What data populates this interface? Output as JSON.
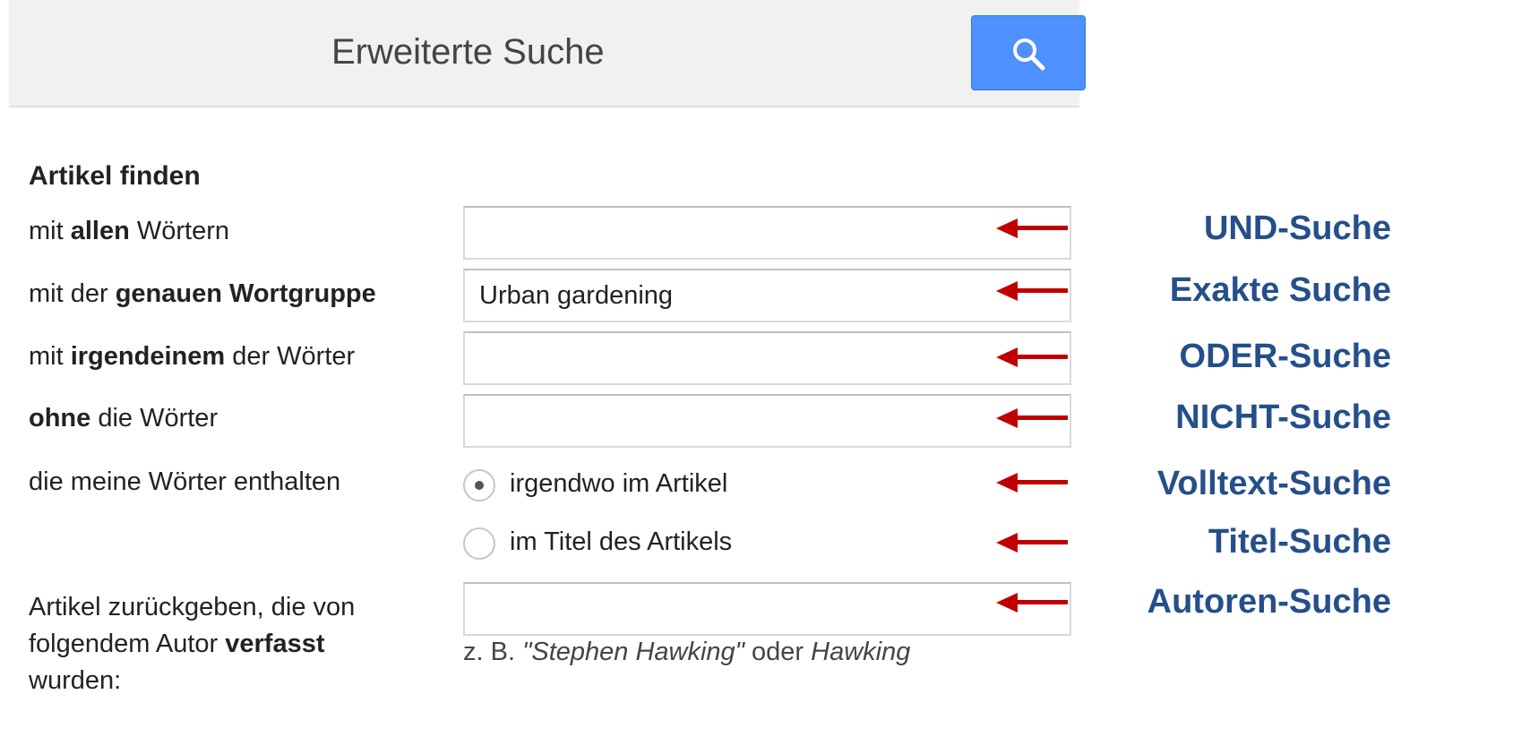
{
  "header": {
    "title": "Erweiterte Suche",
    "search_icon": "search-icon",
    "button_color": "#4d90fe"
  },
  "form": {
    "section_title": "Artikel finden",
    "all_words": {
      "pre": "mit ",
      "bold": "allen",
      "post": " Wörtern",
      "value": ""
    },
    "exact_phrase": {
      "pre": "mit der ",
      "bold": "genauen Wortgruppe",
      "post": "",
      "value": "Urban gardening"
    },
    "any_words": {
      "pre": "mit ",
      "bold": "irgendeinem",
      "post": " der Wörter",
      "value": ""
    },
    "without_words": {
      "pre": "",
      "bold": "ohne",
      "post": " die Wörter",
      "value": ""
    },
    "occurrence": {
      "label": "die meine Wörter enthalten",
      "options": [
        "irgendwo im Artikel",
        "im Titel des Artikels"
      ],
      "selected": "irgendwo im Artikel"
    },
    "author": {
      "line1": "Artikel zurückgeben, die von",
      "line2_pre": "folgendem Autor ",
      "line2_bold": "verfasst",
      "line3": "wurden:",
      "value": "",
      "hint_pre": "z. B. ",
      "hint_italic1": "\"Stephen Hawking\"",
      "hint_mid": " oder ",
      "hint_italic2": "Hawking"
    }
  },
  "annotations": {
    "items": [
      "UND-Suche",
      "Exakte Suche",
      "ODER-Suche",
      "NICHT-Suche",
      "Volltext-Suche",
      "Titel-Suche",
      "Autoren-Suche"
    ],
    "label_color": "#254f8a",
    "arrow_color": "#c00000"
  }
}
